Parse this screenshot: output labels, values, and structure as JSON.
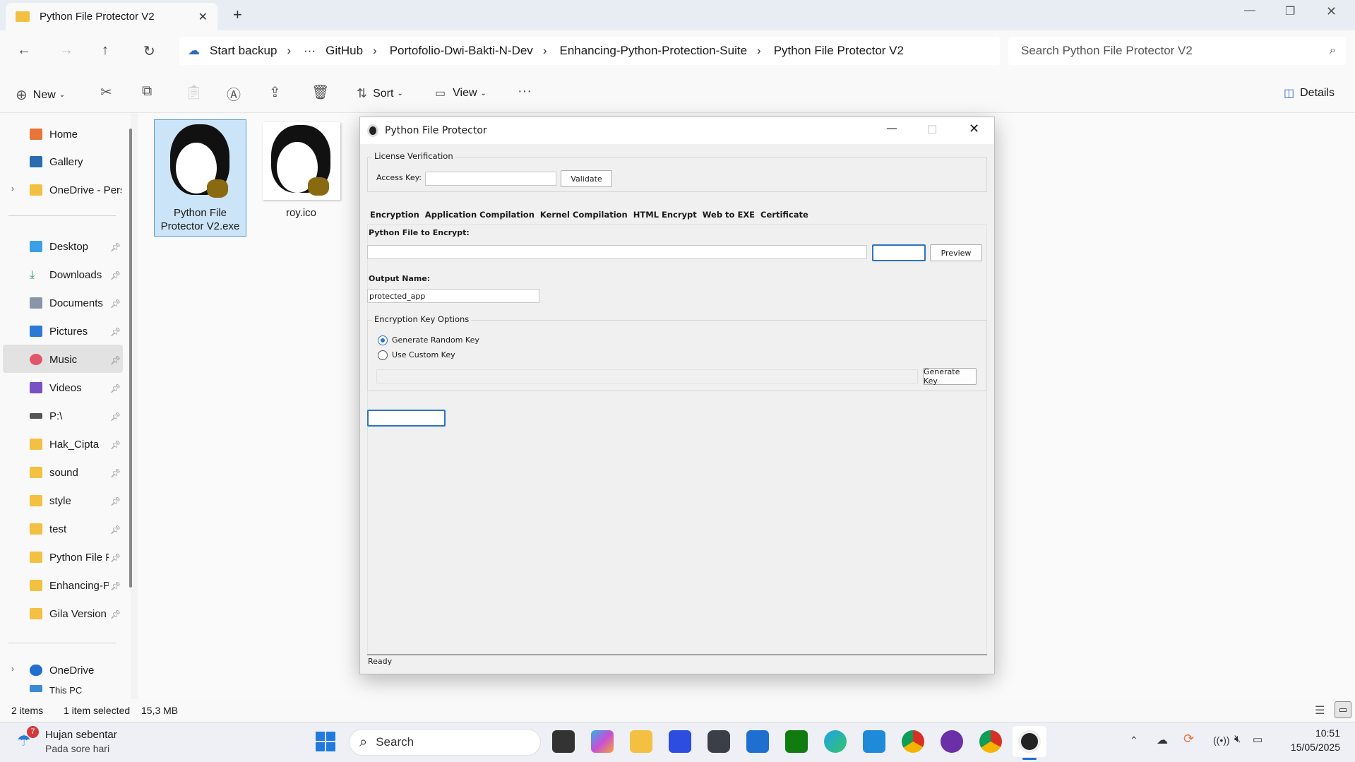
{
  "explorer": {
    "tab_title": "Python File Protector V2",
    "breadcrumb": [
      "Start backup",
      "GitHub",
      "Portofolio-Dwi-Bakti-N-Dev",
      "Enhancing-Python-Protection-Suite",
      "Python File Protector V2"
    ],
    "search_placeholder": "Search Python File Protector V2",
    "toolbar": {
      "new": "New",
      "sort": "Sort",
      "view": "View",
      "details": "Details"
    },
    "sidebar": {
      "top": [
        "Home",
        "Gallery",
        "OneDrive - Perso"
      ],
      "quick": [
        "Desktop",
        "Downloads",
        "Documents",
        "Pictures",
        "Music",
        "Videos",
        "P:\\",
        "Hak_Cipta",
        "sound",
        "style",
        "test",
        "Python File Pr",
        "Enhancing-Py",
        "Gila Version"
      ],
      "bottom": [
        "OneDrive",
        "This PC"
      ]
    },
    "files": [
      {
        "name": "Python File Protector V2.exe",
        "line1": "Python File",
        "line2": "Protector V2.exe"
      },
      {
        "name": "roy.ico",
        "line1": "roy.ico",
        "line2": ""
      }
    ],
    "status": {
      "items": "2 items",
      "selected": "1 item selected",
      "size": "15,3 MB"
    }
  },
  "app": {
    "title": "Python File Protector",
    "license_group": "License Verification",
    "access_key_label": "Access Key:",
    "access_key_value": "",
    "validate": "Validate",
    "tabs": [
      "Encryption",
      "Application Compilation",
      "Kernel Compilation",
      "HTML Encrypt",
      "Web to EXE",
      "Certificate"
    ],
    "file_label": "Python File to Encrypt:",
    "file_value": "",
    "preview": "Preview",
    "output_label": "Output Name:",
    "output_value": "protected_app",
    "key_group": "Encryption Key Options",
    "radio_random": "Generate Random Key",
    "radio_custom": "Use Custom Key",
    "selected_option": "Generate Random Key",
    "generate_key": "Generate Key",
    "status": "Ready"
  },
  "taskbar": {
    "weather_title": "Hujan sebentar",
    "weather_sub": "Pada sore hari",
    "weather_badge": "7",
    "search": "Search",
    "time": "10:51",
    "date": "15/05/2025"
  }
}
